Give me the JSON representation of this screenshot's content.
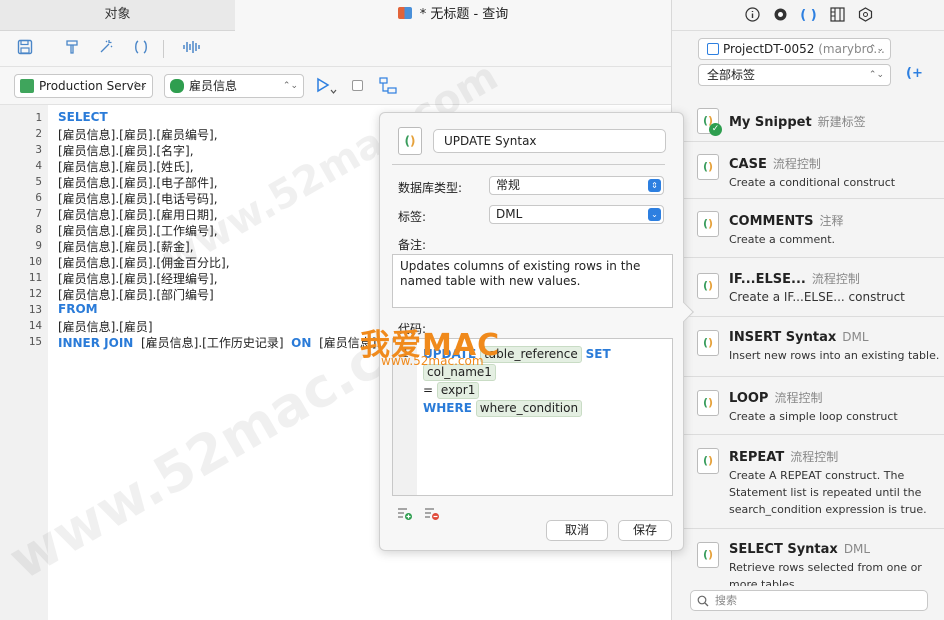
{
  "tabs": {
    "objects": "对象",
    "query": "* 无标题 - 查询"
  },
  "toolbar2": {
    "connection": "Production Server",
    "database": "雇员信息"
  },
  "editor": {
    "line_numbers": [
      "1",
      "2",
      "3",
      "4",
      "5",
      "6",
      "7",
      "8",
      "9",
      "10",
      "11",
      "12",
      "13",
      "14",
      "15"
    ],
    "l1": "SELECT",
    "l2": "[雇员信息].[雇员].[雇员编号],",
    "l3": "[雇员信息].[雇员].[名字],",
    "l4": "[雇员信息].[雇员].[姓氏],",
    "l5": "[雇员信息].[雇员].[电子部件],",
    "l6": "[雇员信息].[雇员].[电话号码],",
    "l7": "[雇员信息].[雇员].[雇用日期],",
    "l8": "[雇员信息].[雇员].[工作编号],",
    "l9": "[雇员信息].[雇员].[薪金],",
    "l10": "[雇员信息].[雇员].[佣金百分比],",
    "l11": "[雇员信息].[雇员].[经理编号],",
    "l12": "[雇员信息].[雇员].[部门编号]",
    "l13": "FROM",
    "l14": "[雇员信息].[雇员]",
    "l15_kw1": "INNER JOIN",
    "l15_t1": "[雇员信息].[工作历史记录]",
    "l15_kw2": "ON",
    "l15_t2": "[雇员信息]."
  },
  "popover": {
    "name": "UPDATE Syntax",
    "db_type_label": "数据库类型:",
    "db_type_value": "常规",
    "tag_label": "标签:",
    "tag_value": "DML",
    "notes_label": "备注:",
    "notes": "Updates columns of existing rows in the named table with new values.",
    "code_label": "代码:",
    "code_line_no": "1",
    "kw_update": "UPDATE",
    "tok_table": "table_reference",
    "kw_set": "SET",
    "tok_col": "col_name1",
    "eq": "=",
    "tok_expr": "expr1",
    "kw_where": "WHERE",
    "tok_where": "where_condition",
    "cancel": "取消",
    "save": "保存"
  },
  "right_panel": {
    "project": "ProjectDT-0052",
    "project_user": "(marybro...",
    "all_tags": "全部标签",
    "search_placeholder": "搜索",
    "snippets": [
      {
        "title": "My Snippet",
        "tag": "新建标签",
        "desc": ""
      },
      {
        "title": "CASE",
        "tag": "流程控制",
        "desc": "Create a conditional construct"
      },
      {
        "title": "COMMENTS",
        "tag": "注释",
        "desc": "Create a comment."
      },
      {
        "title": "IF...ELSE...",
        "tag": "流程控制",
        "desc": "Create a IF...ELSE... construct"
      },
      {
        "title": "INSERT Syntax",
        "tag": "DML",
        "desc": "Insert new rows into an existing table."
      },
      {
        "title": "LOOP",
        "tag": "流程控制",
        "desc": "Create a simple loop construct"
      },
      {
        "title": "REPEAT",
        "tag": "流程控制",
        "desc": "Create A REPEAT construct. The Statement list is repeated until the search_condition expression is true."
      },
      {
        "title": "SELECT Syntax",
        "tag": "DML",
        "desc": "Retrieve rows selected from one or more tables."
      }
    ]
  },
  "watermark": {
    "brand": "我爱MAC",
    "url": "www.52mac.com",
    "bg": "www.52mac.com"
  },
  "colors": {
    "keyword": "#2a7bd8",
    "accent": "#2d7fe0",
    "snippet_icon": "#3a9d5d"
  }
}
